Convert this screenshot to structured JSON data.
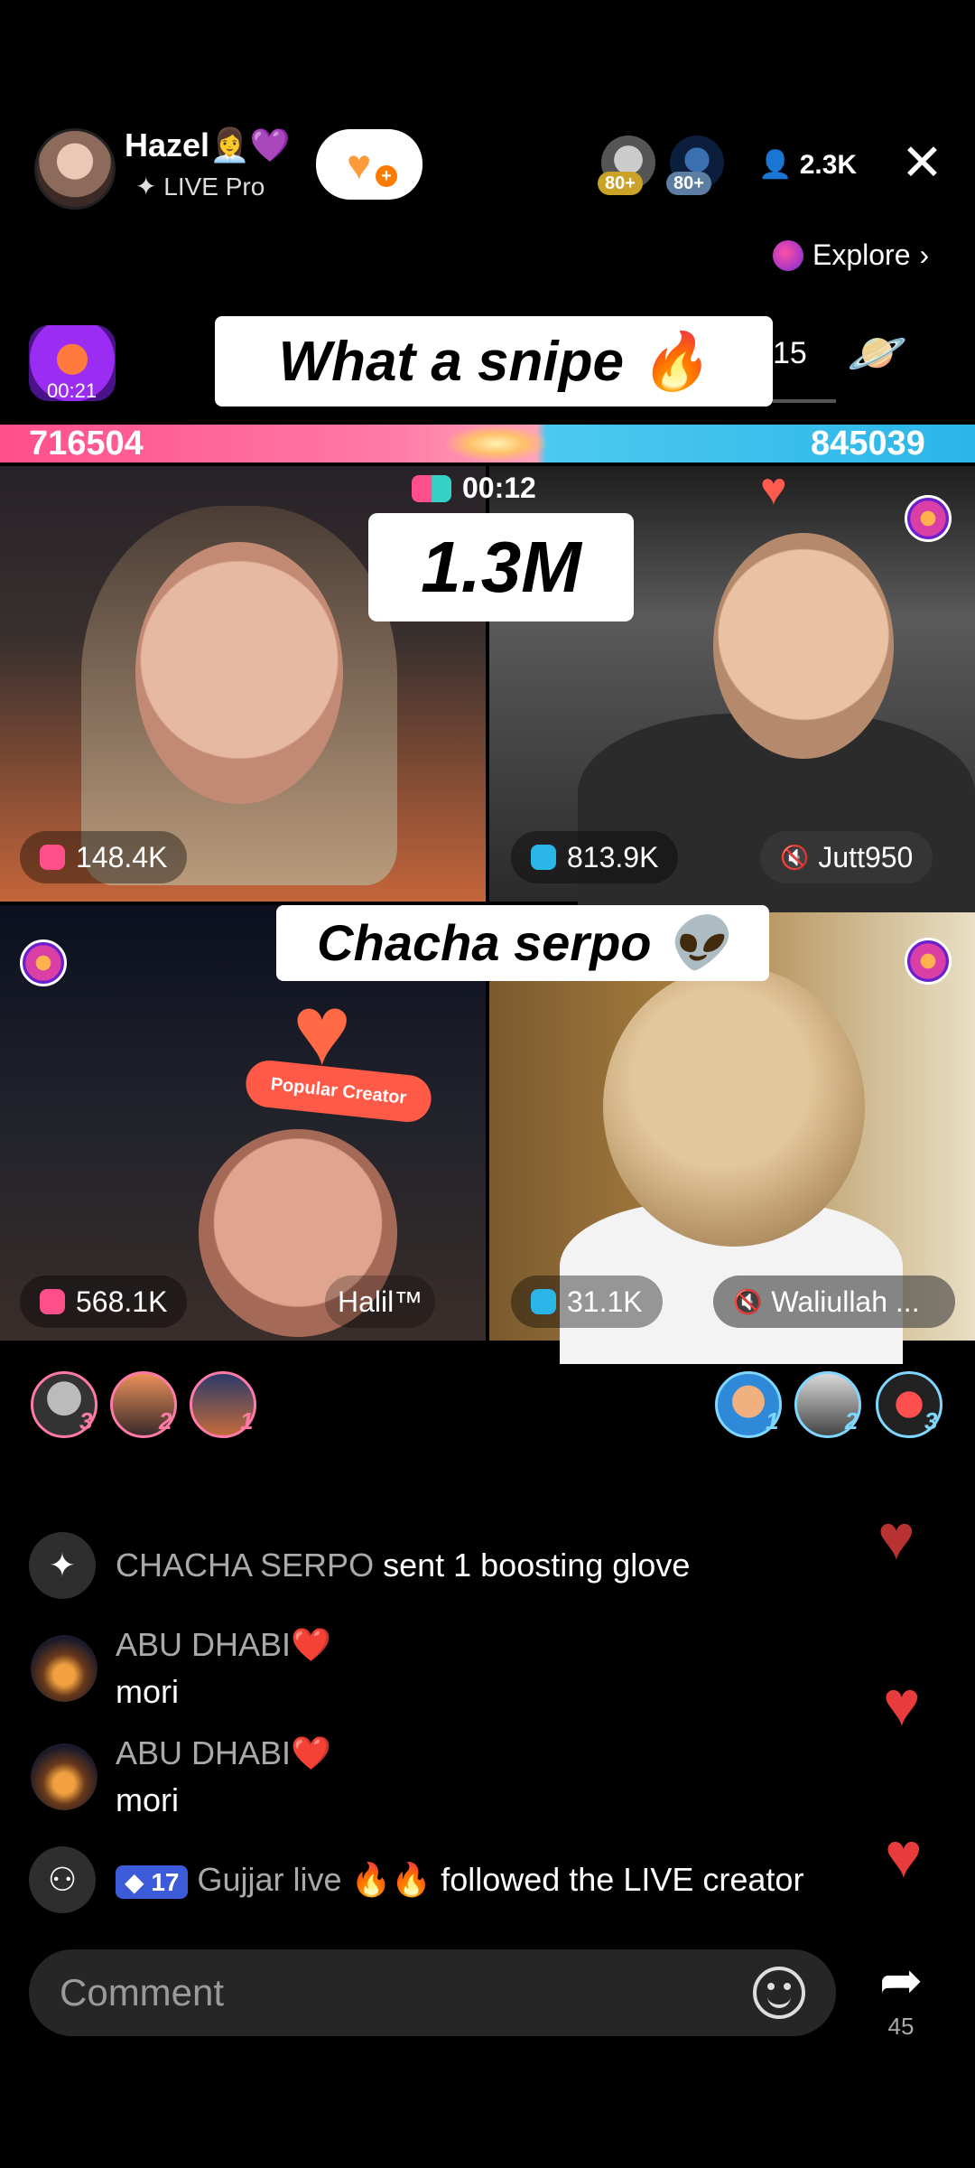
{
  "header": {
    "host_name": "Hazel👩‍💼💜",
    "host_subtitle": "LIVE Pro",
    "rank_badges": [
      "80+",
      "80+"
    ],
    "viewer_count": "2.3K",
    "explore_label": "Explore"
  },
  "battle": {
    "game_timer": "00:21",
    "caption_top": "What a snipe 🔥",
    "count_right": "15",
    "score_left": "716504",
    "score_right": "845039",
    "round_timer": "00:12",
    "center_points": "1.3M",
    "caption_mid": "Chacha serpo 👽"
  },
  "tiles": [
    {
      "stat": "148.4K"
    },
    {
      "stat": "813.9K",
      "name": "Jutt950"
    },
    {
      "stat": "568.1K",
      "name": "Halil™",
      "badge": "Popular Creator"
    },
    {
      "stat": "31.1K",
      "name": "Waliullah ..."
    }
  ],
  "supporters": {
    "left_ranks": [
      "3",
      "2",
      "1"
    ],
    "right_ranks": [
      "1",
      "2",
      "3"
    ]
  },
  "chat": [
    {
      "type": "system",
      "name": "CHACHA SERPO",
      "text": "sent 1 boosting glove"
    },
    {
      "type": "message",
      "name": "ABU DHABI❤️",
      "text": "mori"
    },
    {
      "type": "message",
      "name": "ABU DHABI❤️",
      "text": "mori"
    },
    {
      "type": "follow",
      "level": "17",
      "name": "Gujjar live 🔥🔥",
      "text": "followed the LIVE creator"
    }
  ],
  "composer": {
    "placeholder": "Comment",
    "share_count": "45"
  },
  "colors": {
    "left_team": "#ff4f8b",
    "right_team": "#2bb6e8",
    "heart": "#e83b3b"
  }
}
